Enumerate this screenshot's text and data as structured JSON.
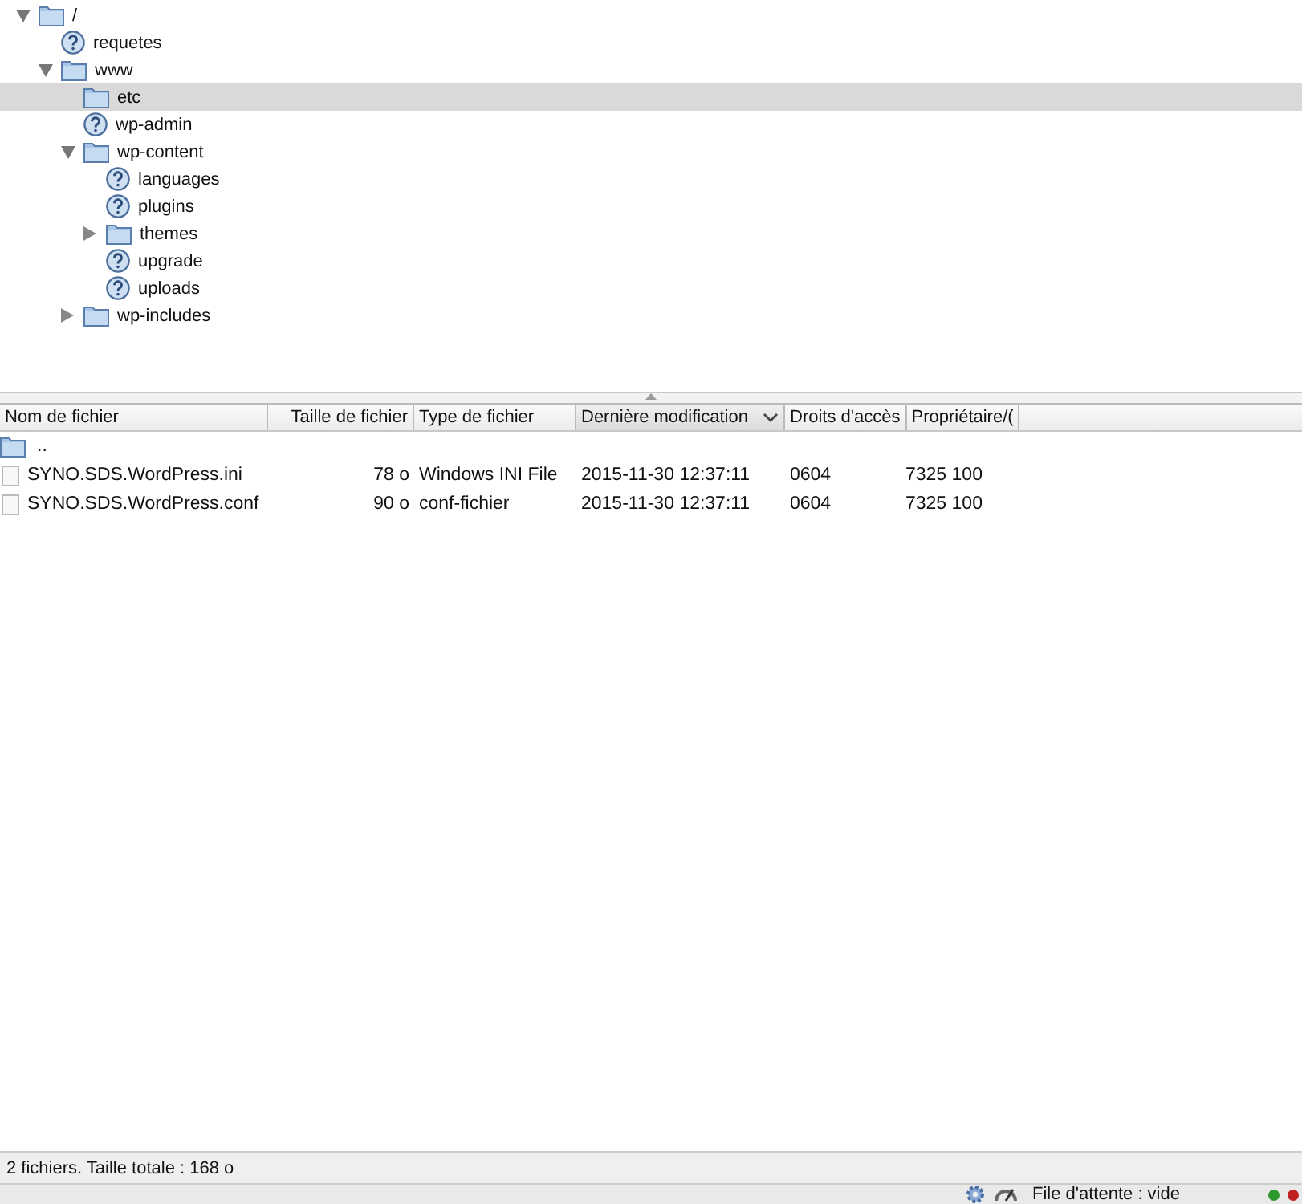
{
  "tree": [
    {
      "label": "/",
      "kind": "folder",
      "expanded": true,
      "selected": false,
      "children": [
        {
          "label": "requetes",
          "kind": "unknown",
          "selected": false
        },
        {
          "label": "www",
          "kind": "folder",
          "expanded": true,
          "selected": false,
          "children": [
            {
              "label": "etc",
              "kind": "folder",
              "selected": true
            },
            {
              "label": "wp-admin",
              "kind": "unknown",
              "selected": false
            },
            {
              "label": "wp-content",
              "kind": "folder",
              "expanded": true,
              "selected": false,
              "children": [
                {
                  "label": "languages",
                  "kind": "unknown",
                  "selected": false
                },
                {
                  "label": "plugins",
                  "kind": "unknown",
                  "selected": false
                },
                {
                  "label": "themes",
                  "kind": "folder",
                  "expanded": false,
                  "selected": false
                },
                {
                  "label": "upgrade",
                  "kind": "unknown",
                  "selected": false
                },
                {
                  "label": "uploads",
                  "kind": "unknown",
                  "selected": false
                }
              ]
            },
            {
              "label": "wp-includes",
              "kind": "folder",
              "expanded": false,
              "selected": false
            }
          ]
        }
      ]
    }
  ],
  "file_list": {
    "columns": [
      {
        "label": "Nom de fichier",
        "sorted": false
      },
      {
        "label": "Taille de fichier",
        "sorted": false
      },
      {
        "label": "Type de fichier",
        "sorted": false
      },
      {
        "label": "Dernière modification",
        "sorted": true
      },
      {
        "label": "Droits d'accès",
        "sorted": false
      },
      {
        "label": "Propriétaire/(",
        "sorted": false
      }
    ],
    "rows": [
      {
        "kind": "parent",
        "name": ".."
      },
      {
        "kind": "file",
        "name": "SYNO.SDS.WordPress.ini",
        "size": "78 o",
        "type": "Windows INI File",
        "modified": "2015-11-30 12:37:11",
        "permissions": "0604",
        "owner": "7325 100"
      },
      {
        "kind": "file",
        "name": "SYNO.SDS.WordPress.conf",
        "size": "90 o",
        "type": "conf-fichier",
        "modified": "2015-11-30 12:37:11",
        "permissions": "0604",
        "owner": "7325 100"
      }
    ]
  },
  "summary": "2 fichiers. Taille totale : 168 o",
  "status_bar": {
    "queue": "File d'attente : vide",
    "lights": [
      {
        "color": "#2e9a2e"
      },
      {
        "color": "#c02020"
      }
    ]
  }
}
